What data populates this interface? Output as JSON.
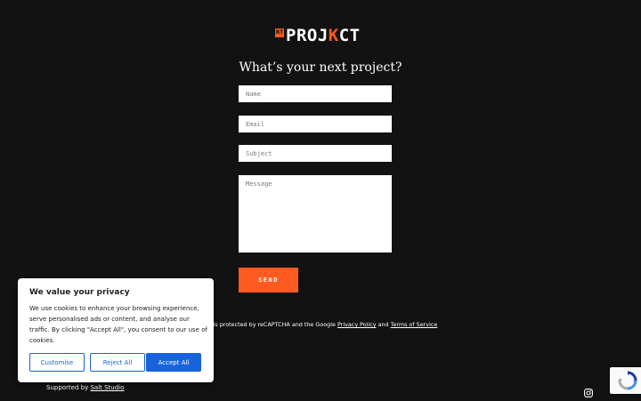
{
  "brand": {
    "mark": "RT",
    "pre": "PROJ",
    "accent": "K",
    "post": "CT",
    "accent_color": "#ff5a1f"
  },
  "form": {
    "heading": "What’s your next project?",
    "name_placeholder": "Name",
    "email_placeholder": "Email",
    "subject_placeholder": "Subject",
    "message_placeholder": "Message",
    "send_label": "SEND"
  },
  "recaptcha_note": {
    "text_before": "site is protected by reCAPTCHA and the Google ",
    "privacy_link": "Privacy Policy",
    "and": " and ",
    "terms_link": "Terms of Service"
  },
  "footer": {
    "supported_by": "Supported by ",
    "studio_link": "Salt Studio"
  },
  "cookie_banner": {
    "title": "We value your privacy",
    "body": "We use cookies to enhance your browsing experience, serve personalised ads or content, and analyse our traffic. By clicking \"Accept All\", you consent to our use of cookies.",
    "customise_label": "Customise",
    "reject_label": "Reject All",
    "accept_label": "Accept All",
    "accent_color": "#1863dc"
  },
  "icons": {
    "social": "instagram-icon",
    "captcha": "recaptcha-icon"
  }
}
